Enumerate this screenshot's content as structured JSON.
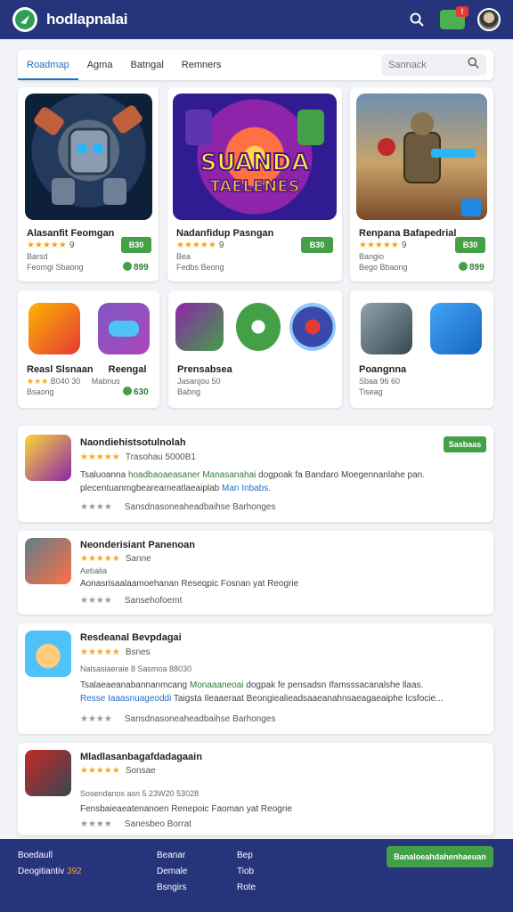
{
  "header": {
    "brand": "hodlapnalai",
    "notification_count": "!",
    "icons": [
      "logo-icon",
      "search-icon",
      "notification-icon",
      "avatar"
    ]
  },
  "tabs": [
    "Roadmap",
    "Agma",
    "Batngal",
    "Remners"
  ],
  "search": {
    "placeholder": "Sannack"
  },
  "featured": [
    {
      "name": "Alasanfit Feomgan",
      "rating": "★★★★★",
      "rating_count": "9",
      "meta1": "Barsd",
      "meta2": "Feomgi Sbaong",
      "button": "B30",
      "price": "899"
    },
    {
      "name": "Nadanfidup Pasngan",
      "rating": "★★★★★",
      "rating_count": "9",
      "meta1": "Bea",
      "meta2": "Fedbs Beong",
      "button": "B30",
      "price": ""
    },
    {
      "name": "Renpana Bafapedrial",
      "rating": "★★★★★",
      "rating_count": "9",
      "meta1": "Bangio",
      "meta2": "Bego Bbaong",
      "button": "B30",
      "price": "899"
    }
  ],
  "featured_art": [
    "SUANDA",
    "TAELENES"
  ],
  "mini": [
    {
      "name": "Reasl Slsnaan",
      "sub": "Reengal",
      "rating": "★★★",
      "meta": "B040 30",
      "meta2": "Bsaong",
      "sub2": "Mabnus",
      "price": "630"
    },
    {
      "name": "Prensabsea",
      "sub": "Jasanjou 50",
      "sub2": "Babng"
    },
    {
      "name": "Poangnna",
      "sub": "Sbaa 96 60",
      "sub2": "Tiseag"
    }
  ],
  "list": [
    {
      "title": "Naondiehistsotulnolah",
      "rating": "★★★★★",
      "meta": "Trasohau 5000B1",
      "badge": "Sasbaas",
      "desc_lead": "Tsaluoanna",
      "desc_green": "hoadbaoaeasaner Manasanahai",
      "desc_mid": " dogpoak fa Bandaro Moegennanlahe pan. ",
      "desc_line2a": "plecentuanmgbeareameatlaeaiplab",
      "desc_line2b": "Man Inbabs.",
      "stars_bottom": "★★★★",
      "link": "Sansdnasoneaheadbaihse Barhonges"
    },
    {
      "title": "Neonderisiant Panenoan",
      "rating": "★★★★★",
      "meta": "Sanne",
      "sub": "Aebalia",
      "desc_lead": "Aonasrisaalaamoehanan Reseqpic Fosnan yat Reogrie",
      "stars_bottom": "★★★★",
      "link": "Sansehofoemt"
    },
    {
      "title": "Resdeanal Bevpdagai",
      "rating": "★★★★★",
      "meta": "Bsnes",
      "sub": "Nalsasiaeraie 8 Sasmoa 88030",
      "desc_lead": "Tsalaeaeanabannanmcang",
      "desc_green": "Monaaaneoai",
      "desc_mid": " dogpak fe pensadsn Ifamsssacanalshe llaas.",
      "desc_line2a": "Resse Iaaasnuageoddi",
      "desc_line2b": "Taigsta Ileaaeraat Beongiealieadsaaeanahnsaeagaeaiphe Icsfocie...",
      "stars_bottom": "★★★★",
      "link": "Sansdnasoneaheadbaihse Barhonges"
    },
    {
      "title": "Mladlasanbagafdadagaain",
      "rating": "★★★★★",
      "meta": "Sonsae",
      "sub": "Sosendanos asn 5 23W20 53028",
      "desc_lead": "Fensbaieaeatenanoen Renepoic Faoman yat Reogrie",
      "stars_bottom": "★★★★",
      "link": "Sanesbeo Borrat"
    }
  ],
  "footer": {
    "col1": [
      "Boedaull",
      "Deogitiantiv"
    ],
    "col1_extra": "392",
    "col2": [
      "Beanar",
      "Demale",
      "Bsngirs"
    ],
    "col3": [
      "Bep",
      "Tiob",
      "Rote"
    ],
    "cta": "Banaloeahdahenhaeuan"
  },
  "colors": {
    "header": "#26347c",
    "accent": "#1f6fc2",
    "green": "#43a047",
    "star": "#f5a623"
  }
}
